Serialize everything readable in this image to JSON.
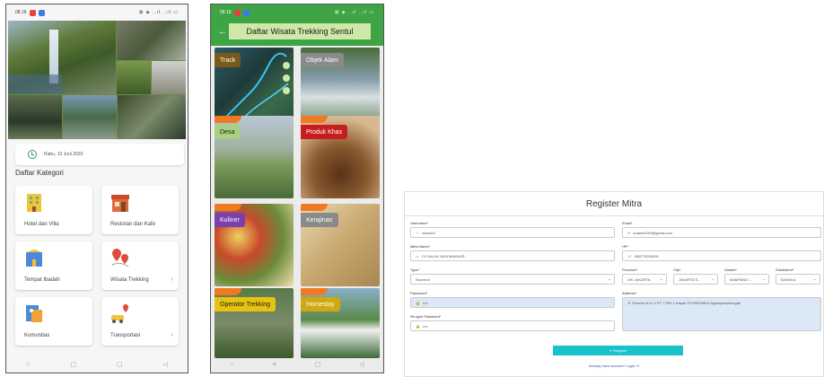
{
  "phone1": {
    "status_time": "08.16",
    "status_right": "⊠ ◈ ..ıl ..ıl ▭",
    "date_text": "Rabu, 10 Juni 2020",
    "section_title": "Daftar Kategori",
    "categories": [
      {
        "label": "Hotel dan Villa",
        "icon": "hotel-icon"
      },
      {
        "label": "Restoran dan Kafe",
        "icon": "restaurant-icon"
      },
      {
        "label": "Tempat Ibadah",
        "icon": "worship-icon"
      },
      {
        "label": "Wisata Trekking",
        "icon": "map-pin-icon",
        "more": "›"
      },
      {
        "label": "Komunitas",
        "icon": "community-icon"
      },
      {
        "label": "Transportasi",
        "icon": "transport-icon",
        "more": "›"
      }
    ],
    "nav": [
      "○",
      "▢",
      "◁",
      "≡"
    ]
  },
  "phone2": {
    "status_time": "08.16",
    "title": "Daftar Wisata Trekking Sentul",
    "back": "←",
    "cards": [
      {
        "label": "Track",
        "color": "#7a5a18"
      },
      {
        "label": "Objek Alam",
        "color": "#8a8a8a"
      },
      {
        "label": "Desa",
        "color": "#a8d080"
      },
      {
        "label": "Produk Khas",
        "color": "#c61e1e"
      },
      {
        "label": "Kuliner",
        "color": "#7b3fb0"
      },
      {
        "label": "Kerajinan",
        "color": "#8a8a8a"
      },
      {
        "label": "Operator Trekking",
        "color": "#e5c310"
      },
      {
        "label": "Homestay",
        "color": "#d0a810"
      }
    ]
  },
  "form": {
    "title": "Register Mitra",
    "username_label": "Username*",
    "username_value": "sutanic2",
    "email_label": "Email*",
    "email_value": "sutanic2009@gmail.com",
    "mitra_label": "Mitra Name*",
    "mitra_value": "CV MULIA JAYA MAKMUR",
    "hp_label": "HP*",
    "hp_value": "088779000000",
    "type_label": "Type*",
    "type_value": "Souvenir",
    "province_label": "Province*",
    "province_value": "DKI JAKARTA",
    "city_label": "City*",
    "city_value": "JAKARTA S...",
    "district_label": "District*",
    "district_value": "MAMPANG ...",
    "subdistrict_label": "Subdistrict*",
    "subdistrict_value": "BANGKA",
    "password_label": "Password*",
    "password_value": "••••",
    "address_label": "Address*",
    "address_value": "Jl. Srimulio 6 no 2 RT 7 RW 1 Dapan PUSKESMAS Ngampakamungan",
    "retype_label": "Re-type Password*",
    "retype_value": "••••",
    "register_button": "✔ Register",
    "login_link": "Already have account? Login ⇥"
  },
  "colors": {
    "header_green": "#3ea446",
    "register_cyan": "#18c2cc"
  }
}
